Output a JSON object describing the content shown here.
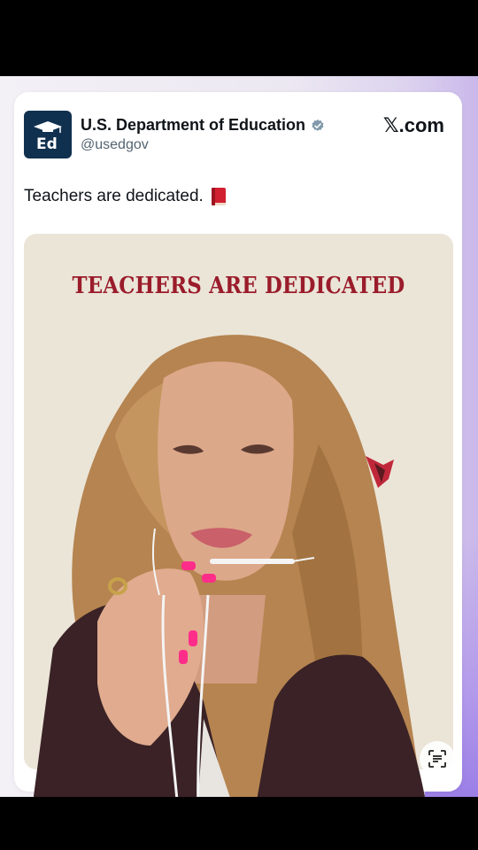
{
  "tweet": {
    "author_name": "U.S. Department of Education",
    "handle": "@usedgov",
    "site": "X.com",
    "site_mark": "𝕏",
    "site_suffix": ".com",
    "text": "Teachers are dedicated.",
    "emoji_icon": "closed-book-icon",
    "verified_icon": "verified-badge-icon",
    "avatar_text": "Ed"
  },
  "media": {
    "title": "TEACHERS ARE DEDICATED",
    "accent_color": "#9a1c2b"
  },
  "colors": {
    "avatar_bg": "#10304f",
    "text": "#0f1419",
    "secondary": "#536471"
  }
}
